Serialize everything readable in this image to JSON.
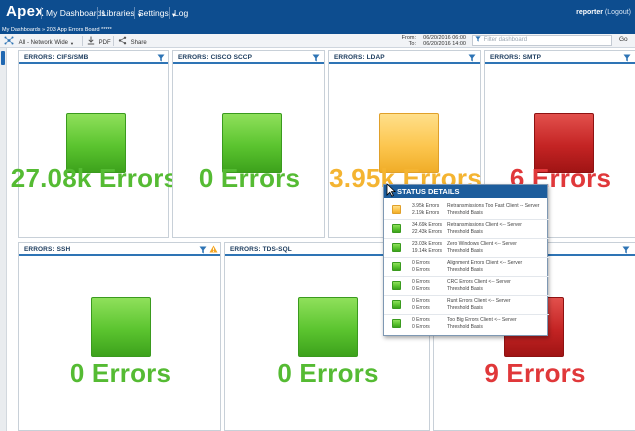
{
  "app": {
    "brand": "Apex",
    "nav": [
      "My Dashboards",
      "Libraries",
      "Settings",
      "Log"
    ],
    "user_name": "reporter",
    "user_action": "(Logout)"
  },
  "breadcrumb": "My Dashboards » 203 App Errors Board *****",
  "toolbar": {
    "scope": "All - Network Wide",
    "pdf": "PDF",
    "share": "Share",
    "from_label": "From:",
    "from_value": "06/20/2016 06:00",
    "to_label": "To:",
    "to_value": "06/20/2016 14:00",
    "filter_placeholder": "Filter dashboard",
    "go": "Go"
  },
  "panels": [
    {
      "title": "ERRORS: CIFS/SMB",
      "value": "27.08k Errors",
      "status": "green"
    },
    {
      "title": "ERRORS: CISCO SCCP",
      "value": "0 Errors",
      "status": "green"
    },
    {
      "title": "ERRORS: LDAP",
      "value": "3.95k Errors",
      "status": "yellow"
    },
    {
      "title": "ERRORS: SMTP",
      "value": "6 Errors",
      "status": "red"
    },
    {
      "title": "ERRORS: SSH",
      "value": "0 Errors",
      "status": "green"
    },
    {
      "title": "ERRORS: TDS-SQL",
      "value": "0 Errors",
      "status": "green"
    },
    {
      "title": "",
      "value": "9 Errors",
      "status": "red"
    }
  ],
  "popup": {
    "title": "STATUS DETAILS",
    "rows": [
      {
        "status": "yellow",
        "val1": "3.95k Errors",
        "val2": "2.19k Errors",
        "desc1": "Retransmissions Too Fast Client -- Server",
        "desc2": "Threshold Basis"
      },
      {
        "status": "green",
        "val1": "34.69k Errors",
        "val2": "22.43k Errors",
        "desc1": "Retransmissions Client <-- Server",
        "desc2": "Threshold Basis"
      },
      {
        "status": "green",
        "val1": "23.03k Errors",
        "val2": "19.14k Errors",
        "desc1": "Zero Windows Client <-- Server",
        "desc2": "Threshold Basis"
      },
      {
        "status": "green",
        "val1": "0 Errors",
        "val2": "0 Errors",
        "desc1": "Alignment Errors Client <-- Server",
        "desc2": "Threshold Basis"
      },
      {
        "status": "green",
        "val1": "0 Errors",
        "val2": "0 Errors",
        "desc1": "CRC Errors Client <-- Server",
        "desc2": "Threshold Basis"
      },
      {
        "status": "green",
        "val1": "0 Errors",
        "val2": "0 Errors",
        "desc1": "Runt Errors Client <-- Server",
        "desc2": "Threshold Basis"
      },
      {
        "status": "green",
        "val1": "0 Errors",
        "val2": "0 Errors",
        "desc1": "Too Big Errors Client <-- Server",
        "desc2": "Threshold Basis"
      }
    ]
  },
  "colors": {
    "nav": "#0d4d8f",
    "green": "#55bb33",
    "yellow": "#f4b431",
    "red": "#e0383a",
    "accent": "#2e74b5"
  }
}
